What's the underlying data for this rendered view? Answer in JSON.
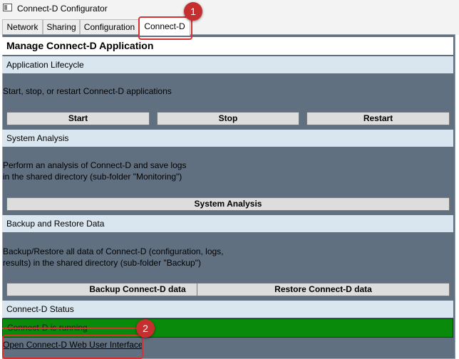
{
  "window": {
    "title": "Connect-D Configurator"
  },
  "tabs": [
    {
      "label": "Network"
    },
    {
      "label": "Sharing"
    },
    {
      "label": "Configuration"
    },
    {
      "label": "Connect-D"
    }
  ],
  "page": {
    "heading": "Manage Connect-D Application"
  },
  "lifecycle": {
    "title": "Application Lifecycle",
    "description": "Start, stop, or restart Connect-D applications",
    "start_label": "Start",
    "stop_label": "Stop",
    "restart_label": "Restart"
  },
  "analysis": {
    "title": "System Analysis",
    "desc_line1": "Perform an analysis of Connect-D and save logs",
    "desc_line2": "in the shared directory (sub-folder \"Monitoring\")",
    "button_label": "System Analysis"
  },
  "backup": {
    "title": "Backup and Restore Data",
    "desc_line1": "Backup/Restore all data of Connect-D (configuration, logs,",
    "desc_line2": "results) in  the shared directory (sub-folder \"Backup\")",
    "backup_label": "Backup Connect-D data",
    "restore_label": "Restore Connect-D data"
  },
  "status": {
    "title": "Connect-D Status",
    "text": "Connect-D is running",
    "color": "#0a8a0a"
  },
  "web_link": "Open Connect-D Web User Interface",
  "annotations": {
    "badge1": "1",
    "badge2": "2",
    "color": "#d73131"
  }
}
